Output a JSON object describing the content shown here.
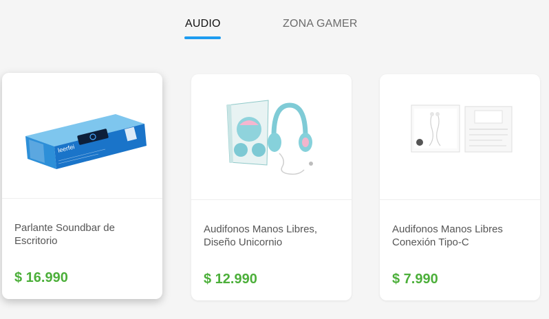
{
  "tabs": [
    {
      "label": "AUDIO",
      "active": true
    },
    {
      "label": "ZONA GAMER",
      "active": false
    }
  ],
  "accent_color": "#1e9cf0",
  "price_color": "#4caf3a",
  "products": [
    {
      "title": "Parlante Soundbar de Escritorio",
      "price": "$ 16.990",
      "image_icon": "soundbar-box-image",
      "brand_on_box": "leerfei"
    },
    {
      "title": "Audifonos Manos Libres, Diseño Unicornio",
      "price": "$ 12.990",
      "image_icon": "unicorn-headphones-image"
    },
    {
      "title": "Audifonos Manos Libres Conexión Tipo-C",
      "price": "$ 7.990",
      "image_icon": "usb-c-earphones-box-image"
    }
  ]
}
